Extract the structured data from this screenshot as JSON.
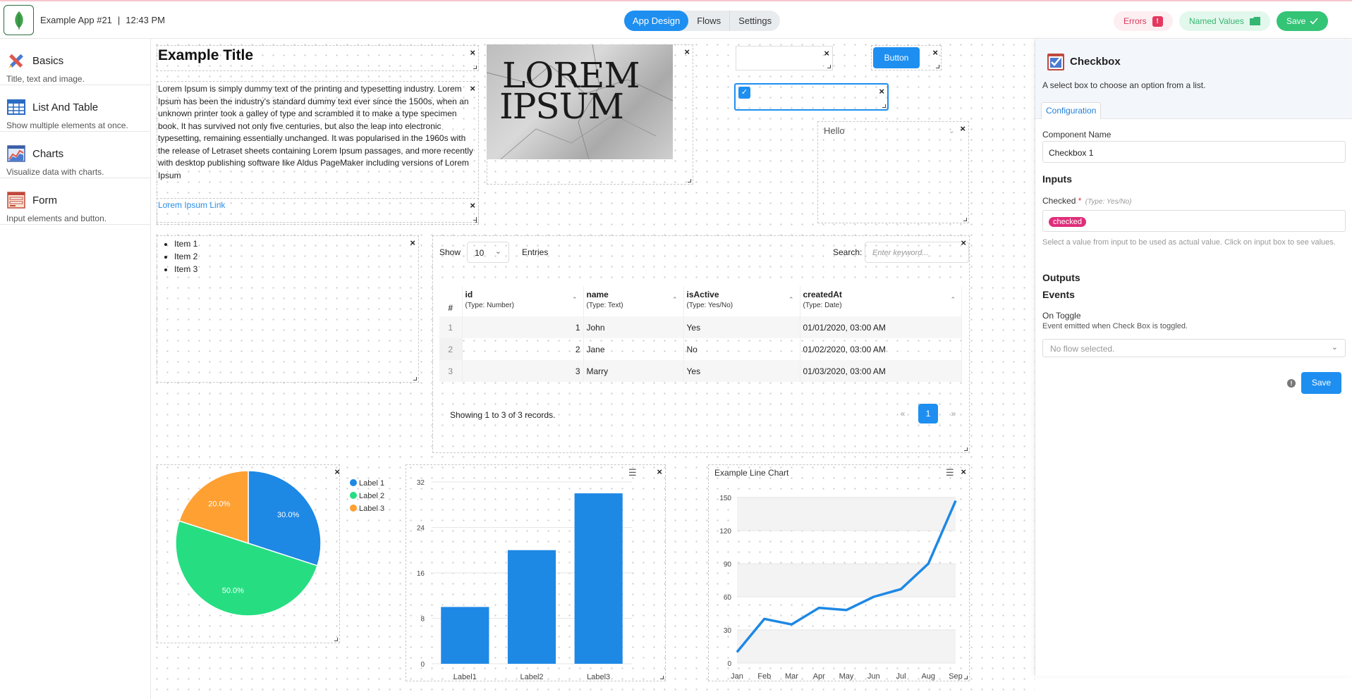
{
  "header": {
    "app_name": "Example App #21",
    "time": "12:43 PM",
    "tabs": [
      {
        "label": "App Design",
        "active": true
      },
      {
        "label": "Flows",
        "active": false
      },
      {
        "label": "Settings",
        "active": false
      }
    ],
    "errors_label": "Errors",
    "errors_badge": "!",
    "named_values_label": "Named Values",
    "save_label": "Save"
  },
  "sidebar": {
    "items": [
      {
        "title": "Basics",
        "desc": "Title, text and image.",
        "icon": "pencil-ruler-icon"
      },
      {
        "title": "List And Table",
        "desc": "Show multiple elements at once.",
        "icon": "table-icon"
      },
      {
        "title": "Charts",
        "desc": "Visualize data with charts.",
        "icon": "chart-icon"
      },
      {
        "title": "Form",
        "desc": "Input elements and button.",
        "icon": "form-icon"
      }
    ]
  },
  "canvas": {
    "title": "Example Title",
    "paragraph": "Lorem Ipsum is simply dummy text of the printing and typesetting industry. Lorem Ipsum has been the industry's standard dummy text ever since the 1500s, when an unknown printer took a galley of type and scrambled it to make a type specimen book. It has survived not only five centuries, but also the leap into electronic typesetting, remaining essentially unchanged. It was popularised in the 1960s with the release of Letraset sheets containing Lorem Ipsum passages, and more recently with desktop publishing software like Aldus PageMaker including versions of Lorem Ipsum",
    "link": "Lorem Ipsum Link",
    "image_text_1": "LOREM",
    "image_text_2": "IPSUM",
    "button_label": "Button",
    "dropdown_value": "Hello",
    "list_items": [
      "Item 1",
      "Item 2",
      "Item 3"
    ],
    "close_symbol": "×"
  },
  "table": {
    "show_label": "Show",
    "page_size": "10",
    "entries_label": "Entries",
    "search_label": "Search:",
    "search_placeholder": "Enter keyword...",
    "index_header": "#",
    "columns": [
      {
        "name": "id",
        "type": "(Type: Number)"
      },
      {
        "name": "name",
        "type": "(Type: Text)"
      },
      {
        "name": "isActive",
        "type": "(Type: Yes/No)"
      },
      {
        "name": "createdAt",
        "type": "(Type: Date)"
      }
    ],
    "rows": [
      {
        "idx": "1",
        "id": "1",
        "name": "John",
        "isActive": "Yes",
        "createdAt": "01/01/2020, 03:00 AM"
      },
      {
        "idx": "2",
        "id": "2",
        "name": "Jane",
        "isActive": "No",
        "createdAt": "01/02/2020, 03:00 AM"
      },
      {
        "idx": "3",
        "id": "3",
        "name": "Marry",
        "isActive": "Yes",
        "createdAt": "01/03/2020, 03:00 AM"
      }
    ],
    "footer": "Showing 1 to 3 of 3 records.",
    "prev": "«",
    "page": "1",
    "next": "»"
  },
  "chart_data": [
    {
      "type": "pie",
      "labels": [
        "Label 1",
        "Label 2",
        "Label 3"
      ],
      "values": [
        30,
        50,
        20
      ],
      "value_labels": [
        "30.0%",
        "50.0%",
        "20.0%"
      ],
      "colors": [
        "#1e88e5",
        "#26de81",
        "#ffa033"
      ],
      "legend": "right"
    },
    {
      "type": "bar",
      "categories": [
        "Label1",
        "Label2",
        "Label3"
      ],
      "values": [
        10,
        20,
        30
      ],
      "ylim": [
        0,
        32
      ],
      "yticks": [
        "32",
        "24",
        "16",
        "8",
        "0"
      ],
      "color": "#1e88e5",
      "grid": true
    },
    {
      "type": "line",
      "title": "Example Line Chart",
      "categories": [
        "Jan",
        "Feb",
        "Mar",
        "Apr",
        "May",
        "Jun",
        "Jul",
        "Aug",
        "Sep"
      ],
      "values": [
        10,
        40,
        35,
        50,
        48,
        60,
        67,
        90,
        147
      ],
      "ylim": [
        0,
        150
      ],
      "yticks": [
        "150",
        "120",
        "90",
        "60",
        "30",
        "0"
      ],
      "color": "#1e88e5",
      "grid": true
    }
  ],
  "right_panel": {
    "title": "Checkbox",
    "description": "A select box to choose an option from a list.",
    "tab": "Configuration",
    "component_name_label": "Component Name",
    "component_name_value": "Checkbox 1",
    "inputs_heading": "Inputs",
    "checked_label": "Checked",
    "required_mark": "*",
    "checked_type": "(Type: Yes/No)",
    "checked_chip": "checked",
    "checked_note": "Select a value from input to be used as actual value. Click on input box to see values.",
    "outputs_heading": "Outputs",
    "events_heading": "Events",
    "on_toggle_label": "On Toggle",
    "on_toggle_desc": "Event emitted when Check Box is toggled.",
    "flow_placeholder": "No flow selected.",
    "save_label": "Save",
    "warn_symbol": "!"
  }
}
